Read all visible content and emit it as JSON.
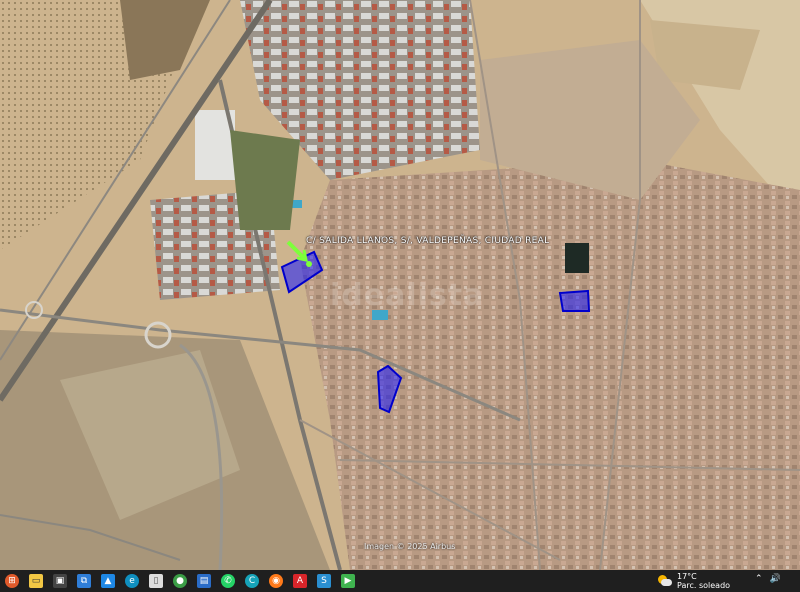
{
  "map": {
    "place_label": "C/ SALIDA LLANOS, S/, VALDEPEÑAS, CIUDAD REAL",
    "attribution": "Imagen © 2025 Airbus",
    "watermark": "idealista",
    "colors": {
      "highlight_fill": "#1a1aff",
      "highlight_stroke": "#0000cc",
      "pin": "#7dff3a",
      "urban": "#b89a83",
      "field_light": "#cdb48e",
      "field_dark": "#8a7658"
    }
  },
  "taskbar": {
    "icons": [
      "windows-start",
      "file-explorer",
      "task-view",
      "network",
      "photos",
      "edge",
      "file",
      "chrome",
      "save",
      "whatsapp",
      "edge-2",
      "firefox",
      "acrobat",
      "app-s",
      "app-green"
    ],
    "weather": {
      "temperature": "17°C",
      "condition": "Parc. soleado"
    }
  }
}
